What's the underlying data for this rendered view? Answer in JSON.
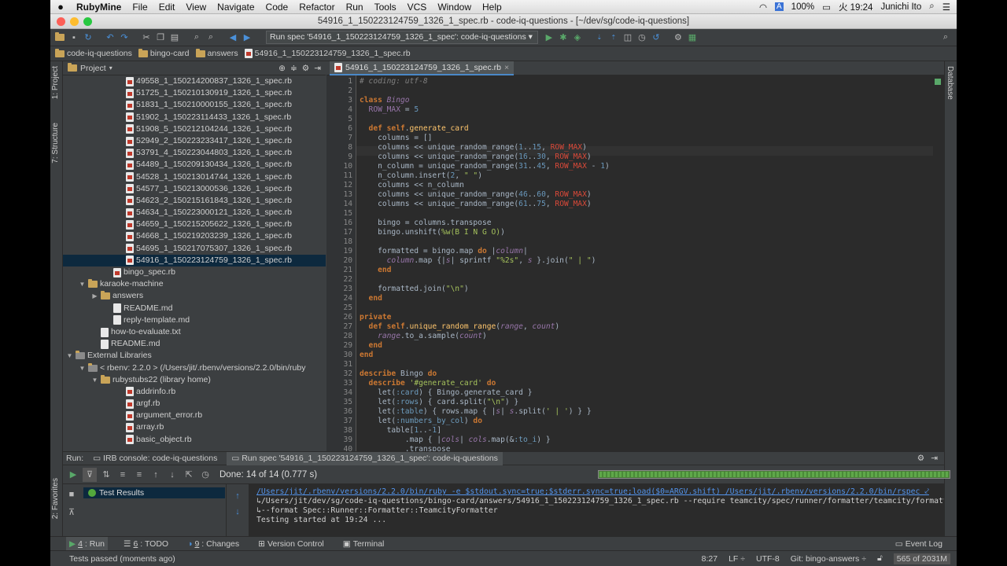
{
  "menubar": {
    "app": "RubyMine",
    "items": [
      "File",
      "Edit",
      "View",
      "Navigate",
      "Code",
      "Refactor",
      "Run",
      "Tools",
      "VCS",
      "Window",
      "Help"
    ],
    "battery": "100%",
    "clock": "火 19:24",
    "user": "Junichi Ito"
  },
  "window_title": "54916_1_150223124759_1326_1_spec.rb - code-iq-questions - [~/dev/sg/code-iq-questions]",
  "toolbar": {
    "run_config": "Run spec '54916_1_150223124759_1326_1_spec': code-iq-questions"
  },
  "breadcrumbs": [
    "code-iq-questions",
    "bingo-card",
    "answers",
    "54916_1_150223124759_1326_1_spec.rb"
  ],
  "side_tabs": {
    "project": "1: Project",
    "structure": "7: Structure",
    "favorites": "2: Favorites",
    "database": "Database"
  },
  "project": {
    "header": "Project",
    "rows": [
      {
        "label": "49558_1_150214200837_1326_1_spec.rb",
        "type": "rb",
        "indent": 4
      },
      {
        "label": "51725_1_150210130919_1326_1_spec.rb",
        "type": "rb",
        "indent": 4
      },
      {
        "label": "51831_1_150210000155_1326_1_spec.rb",
        "type": "rb",
        "indent": 4
      },
      {
        "label": "51902_1_150223114433_1326_1_spec.rb",
        "type": "rb",
        "indent": 4
      },
      {
        "label": "51908_5_150212104244_1326_1_spec.rb",
        "type": "rb",
        "indent": 4
      },
      {
        "label": "52949_2_150223233417_1326_1_spec.rb",
        "type": "rb",
        "indent": 4
      },
      {
        "label": "53791_4_150223044803_1326_1_spec.rb",
        "type": "rb",
        "indent": 4
      },
      {
        "label": "54489_1_150209130434_1326_1_spec.rb",
        "type": "rb",
        "indent": 4
      },
      {
        "label": "54528_1_150213014744_1326_1_spec.rb",
        "type": "rb",
        "indent": 4
      },
      {
        "label": "54577_1_150213000536_1326_1_spec.rb",
        "type": "rb",
        "indent": 4
      },
      {
        "label": "54623_2_150215161843_1326_1_spec.rb",
        "type": "rb",
        "indent": 4
      },
      {
        "label": "54634_1_150223000121_1326_1_spec.rb",
        "type": "rb",
        "indent": 4
      },
      {
        "label": "54659_1_150215205622_1326_1_spec.rb",
        "type": "rb",
        "indent": 4
      },
      {
        "label": "54668_1_150219203239_1326_1_spec.rb",
        "type": "rb",
        "indent": 4
      },
      {
        "label": "54695_1_150217075307_1326_1_spec.rb",
        "type": "rb",
        "indent": 4
      },
      {
        "label": "54916_1_150223124759_1326_1_spec.rb",
        "type": "rb",
        "indent": 4,
        "selected": true
      },
      {
        "label": "bingo_spec.rb",
        "type": "rb",
        "indent": 3
      },
      {
        "label": "karaoke-machine",
        "type": "folder",
        "indent": 1,
        "arrow": "▼"
      },
      {
        "label": "answers",
        "type": "folder",
        "indent": 2,
        "arrow": "▶"
      },
      {
        "label": "README.md",
        "type": "md",
        "indent": 3
      },
      {
        "label": "reply-template.md",
        "type": "md",
        "indent": 3
      },
      {
        "label": "how-to-evaluate.txt",
        "type": "txt",
        "indent": 2
      },
      {
        "label": "README.md",
        "type": "md",
        "indent": 2
      },
      {
        "label": "External Libraries",
        "type": "lib",
        "indent": 0,
        "arrow": "▼"
      },
      {
        "label": "< rbenv: 2.2.0 > (/Users/jit/.rbenv/versions/2.2.0/bin/ruby",
        "type": "lib",
        "indent": 1,
        "arrow": "▼"
      },
      {
        "label": "rubystubs22 (library home)",
        "type": "folder",
        "indent": 2,
        "arrow": "▼"
      },
      {
        "label": "addrinfo.rb",
        "type": "rb",
        "indent": 4
      },
      {
        "label": "argf.rb",
        "type": "rb",
        "indent": 4
      },
      {
        "label": "argument_error.rb",
        "type": "rb",
        "indent": 4
      },
      {
        "label": "array.rb",
        "type": "rb",
        "indent": 4
      },
      {
        "label": "basic_object.rb",
        "type": "rb",
        "indent": 4
      }
    ]
  },
  "editor": {
    "tab": "54916_1_150223124759_1326_1_spec.rb",
    "lines": [
      [
        [
          "cm",
          "# coding: utf-8"
        ]
      ],
      [],
      [
        [
          "k",
          "class "
        ],
        [
          "cst",
          "Bingo"
        ]
      ],
      [
        [
          "cn",
          "  ROW_MAX"
        ],
        [
          "p",
          " = "
        ],
        [
          "n",
          "5"
        ]
      ],
      [],
      [
        [
          "k",
          "  def "
        ],
        [
          "k",
          "self"
        ],
        [
          "p",
          "."
        ],
        [
          "m",
          "generate_card"
        ]
      ],
      [
        [
          "p",
          "    columns = []"
        ]
      ],
      [
        [
          "p",
          "    columns << unique_random_range("
        ],
        [
          "n",
          "1"
        ],
        [
          "p",
          ".."
        ],
        [
          "n",
          "15"
        ],
        [
          "p",
          ", "
        ],
        [
          "rd",
          "ROW_MAX"
        ],
        [
          "p",
          ")"
        ]
      ],
      [
        [
          "p",
          "    columns << unique_random_range("
        ],
        [
          "n",
          "16"
        ],
        [
          "p",
          ".."
        ],
        [
          "n",
          "30"
        ],
        [
          "p",
          ", "
        ],
        [
          "rd",
          "ROW_MAX"
        ],
        [
          "p",
          ")"
        ]
      ],
      [
        [
          "p",
          "    n_column = unique_random_range("
        ],
        [
          "n",
          "31"
        ],
        [
          "p",
          ".."
        ],
        [
          "n",
          "45"
        ],
        [
          "p",
          ", "
        ],
        [
          "rd",
          "ROW_MAX"
        ],
        [
          "p",
          " - "
        ],
        [
          "n",
          "1"
        ],
        [
          "p",
          ")"
        ]
      ],
      [
        [
          "p",
          "    n_column.insert("
        ],
        [
          "n",
          "2"
        ],
        [
          "p",
          ", "
        ],
        [
          "s",
          "\" \""
        ],
        [
          "p",
          ")"
        ]
      ],
      [
        [
          "p",
          "    columns << n_column"
        ]
      ],
      [
        [
          "p",
          "    columns << unique_random_range("
        ],
        [
          "n",
          "46"
        ],
        [
          "p",
          ".."
        ],
        [
          "n",
          "60"
        ],
        [
          "p",
          ", "
        ],
        [
          "rd",
          "ROW_MAX"
        ],
        [
          "p",
          ")"
        ]
      ],
      [
        [
          "p",
          "    columns << unique_random_range("
        ],
        [
          "n",
          "61"
        ],
        [
          "p",
          ".."
        ],
        [
          "n",
          "75"
        ],
        [
          "p",
          ", "
        ],
        [
          "rd",
          "ROW_MAX"
        ],
        [
          "p",
          ")"
        ]
      ],
      [],
      [
        [
          "p",
          "    bingo = columns.transpose"
        ]
      ],
      [
        [
          "p",
          "    bingo.unshift("
        ],
        [
          "s",
          "%w(B I N G O)"
        ],
        [
          "p",
          ")"
        ]
      ],
      [],
      [
        [
          "p",
          "    formatted = bingo.map "
        ],
        [
          "k",
          "do"
        ],
        [
          "p",
          " |"
        ],
        [
          "cst",
          "column"
        ],
        [
          "p",
          "|"
        ]
      ],
      [
        [
          "p",
          "      "
        ],
        [
          "cst",
          "column"
        ],
        [
          "p",
          ".map {|"
        ],
        [
          "cst",
          "s"
        ],
        [
          "p",
          "| sprintf "
        ],
        [
          "s",
          "\"%2s\""
        ],
        [
          "p",
          ", "
        ],
        [
          "cst",
          "s"
        ],
        [
          "p",
          " }.join("
        ],
        [
          "s",
          "\" | \""
        ],
        [
          "p",
          ")"
        ]
      ],
      [
        [
          "k",
          "    end"
        ]
      ],
      [],
      [
        [
          "p",
          "    formatted.join("
        ],
        [
          "s",
          "\"\\n\""
        ],
        [
          "p",
          ")"
        ]
      ],
      [
        [
          "k",
          "  end"
        ]
      ],
      [],
      [
        [
          "k",
          "private"
        ]
      ],
      [
        [
          "k",
          "  def "
        ],
        [
          "k",
          "self"
        ],
        [
          "p",
          "."
        ],
        [
          "m",
          "unique_random_range"
        ],
        [
          "p",
          "("
        ],
        [
          "cst",
          "range"
        ],
        [
          "p",
          ", "
        ],
        [
          "cst",
          "count"
        ],
        [
          "p",
          ")"
        ]
      ],
      [
        [
          "p",
          "    "
        ],
        [
          "cst",
          "range"
        ],
        [
          "p",
          ".to_a.sample("
        ],
        [
          "cst",
          "count"
        ],
        [
          "p",
          ")"
        ]
      ],
      [
        [
          "k",
          "  end"
        ]
      ],
      [
        [
          "k",
          "end"
        ]
      ],
      [],
      [
        [
          "k",
          "describe "
        ],
        [
          "p",
          "Bingo "
        ],
        [
          "k",
          "do"
        ]
      ],
      [
        [
          "k",
          "  describe "
        ],
        [
          "s",
          "'#generate_card'"
        ],
        [
          "k",
          " do"
        ]
      ],
      [
        [
          "p",
          "    let("
        ],
        [
          "sym",
          ":card"
        ],
        [
          "p",
          ") { "
        ],
        [
          "p",
          "Bingo.generate_card }"
        ]
      ],
      [
        [
          "p",
          "    let("
        ],
        [
          "sym",
          ":rows"
        ],
        [
          "p",
          ") { card.split("
        ],
        [
          "s",
          "\"\\n\""
        ],
        [
          "p",
          ") }"
        ]
      ],
      [
        [
          "p",
          "    let("
        ],
        [
          "sym",
          ":table"
        ],
        [
          "p",
          ") { rows.map { |"
        ],
        [
          "cst",
          "s"
        ],
        [
          "p",
          "| "
        ],
        [
          "cst",
          "s"
        ],
        [
          "p",
          ".split("
        ],
        [
          "s",
          "' | '"
        ],
        [
          "p",
          ") } }"
        ]
      ],
      [
        [
          "p",
          "    let("
        ],
        [
          "sym",
          ":numbers_by_col"
        ],
        [
          "p",
          ") "
        ],
        [
          "k",
          "do"
        ]
      ],
      [
        [
          "p",
          "      table["
        ],
        [
          "n",
          "1"
        ],
        [
          "p",
          "..-"
        ],
        [
          "n",
          "1"
        ],
        [
          "p",
          "]"
        ]
      ],
      [
        [
          "p",
          "          .map { |"
        ],
        [
          "cst",
          "cols"
        ],
        [
          "p",
          "| "
        ],
        [
          "cst",
          "cols"
        ],
        [
          "p",
          ".map(&"
        ],
        [
          "sym",
          ":to_i"
        ],
        [
          "p",
          ") }"
        ]
      ],
      [
        [
          "p",
          "          .transpose"
        ]
      ]
    ]
  },
  "run_panel": {
    "label": "Run:",
    "tabs": [
      "IRB console: code-iq-questions",
      "Run spec '54916_1_150223124759_1326_1_spec': code-iq-questions"
    ],
    "done": "Done: 14 of 14",
    "time": "(0.777 s)",
    "progress": 1.0,
    "test_root": "Test Results",
    "console": [
      "/Users/jit/.rbenv/versions/2.2.0/bin/ruby -e $stdout.sync=true;$stderr.sync=true;load($0=ARGV.shift) /Users/jit/.rbenv/versions/2.2.0/bin/rspec ⤦",
      "↳/Users/jit/dev/sg/code-iq-questions/bingo-card/answers/54916_1_150223124759_1326_1_spec.rb --require teamcity/spec/runner/formatter/teamcity/formatter ⤦",
      "↳--format Spec::Runner::Formatter::TeamcityFormatter",
      "Testing started at 19:24 ..."
    ]
  },
  "bottom_tabs": [
    {
      "key": "4",
      "label": ": Run",
      "active": true
    },
    {
      "key": "6",
      "label": ": TODO"
    },
    {
      "key": "9",
      "label": ": Changes"
    },
    {
      "key": "",
      "label": "Version Control"
    },
    {
      "key": "",
      "label": "Terminal"
    }
  ],
  "event_log": "Event Log",
  "status": {
    "message": "Tests passed (moments ago)",
    "position": "8:27",
    "line_sep": "LF ÷",
    "encoding": "UTF-8",
    "git": "Git: bingo-answers ÷",
    "memory": "565 of 2031M"
  },
  "colors": {
    "bg": "#2b2b2b",
    "panel": "#3c3f41",
    "selection": "#0d293e",
    "keyword": "#cc7832",
    "string": "#a5c25c",
    "number": "#6897bb",
    "progress": "#5fa84a"
  }
}
